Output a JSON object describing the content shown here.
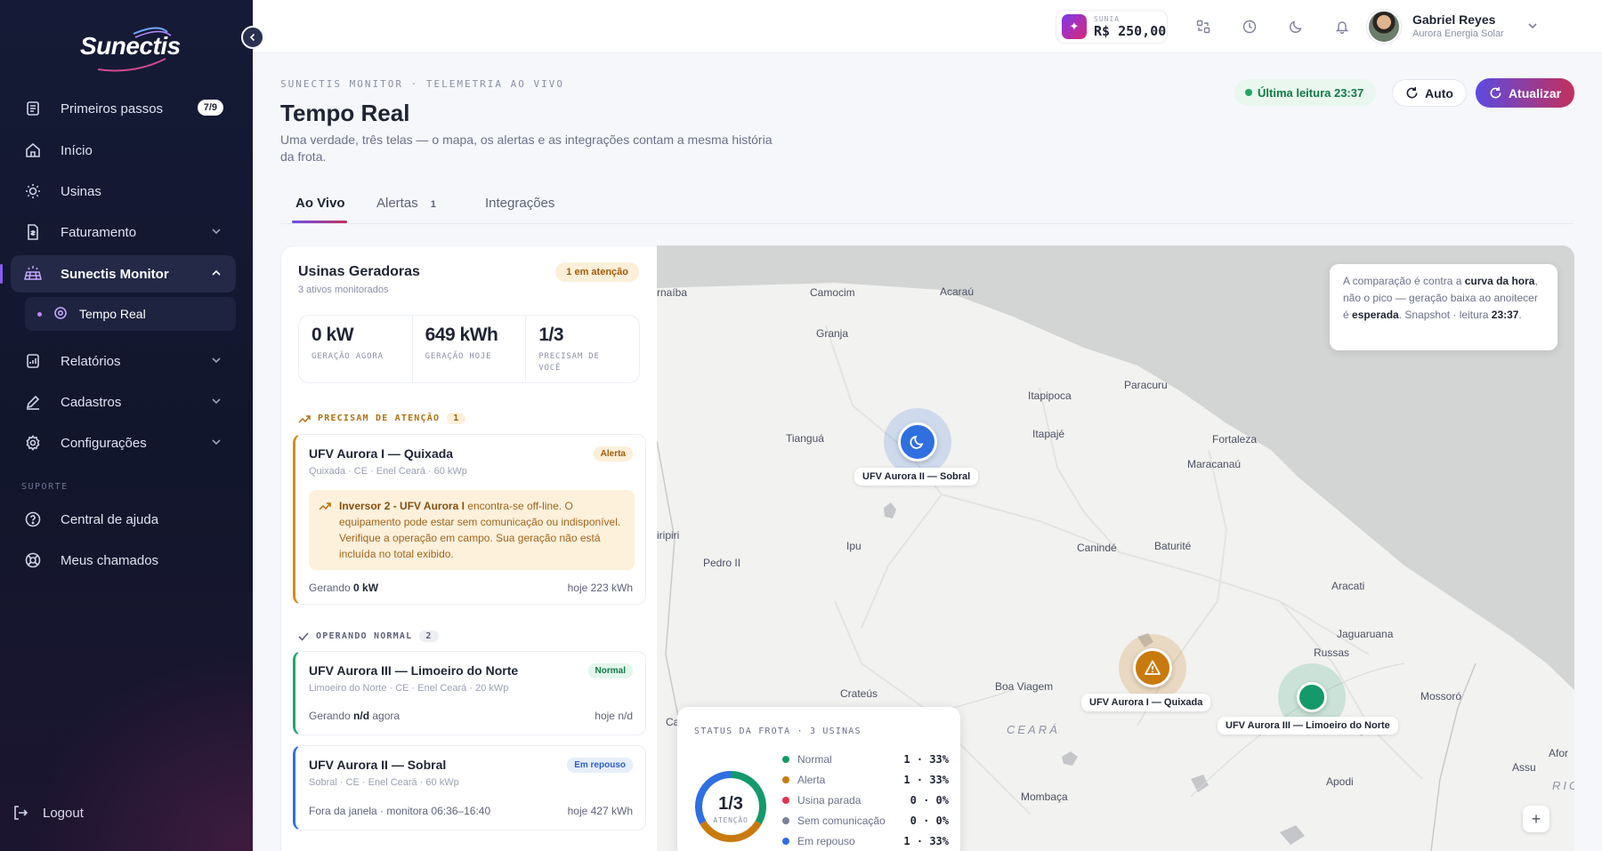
{
  "brand": {
    "name": "Sunectis"
  },
  "sidebar": {
    "items": [
      {
        "label": "Primeiros passos",
        "badge": "7/9",
        "icon": "checklist-icon"
      },
      {
        "label": "Início",
        "icon": "home-icon"
      },
      {
        "label": "Usinas",
        "icon": "sun-icon"
      },
      {
        "label": "Faturamento",
        "icon": "invoice-icon"
      },
      {
        "label": "Sunectis Monitor",
        "icon": "solar-panel-icon"
      },
      {
        "label": "Relatórios",
        "icon": "report-icon"
      },
      {
        "label": "Cadastros",
        "icon": "edit-icon"
      },
      {
        "label": "Configurações",
        "icon": "gear-icon"
      }
    ],
    "subitem": {
      "label": "Tempo Real",
      "icon": "location-icon"
    },
    "support_label": "SUPORTE",
    "support": [
      {
        "label": "Central de ajuda",
        "icon": "help-icon"
      },
      {
        "label": "Meus chamados",
        "icon": "lifebuoy-icon"
      }
    ],
    "logout": "Logout"
  },
  "topbar": {
    "wallet_label": "SUNIA",
    "wallet_value": "R$ 250,00",
    "user_name": "Gabriel Reyes",
    "user_org": "Aurora Energia Solar"
  },
  "header": {
    "kicker": "SUNECTIS MONITOR · TELEMETRIA AO VIVO",
    "title": "Tempo Real",
    "subtitle": "Uma verdade, três telas — o mapa, os alertas e as integrações contam a mesma história da frota.",
    "last_read": "Última leitura 23:37",
    "auto_label": "Auto",
    "refresh_label": "Atualizar"
  },
  "tabs": [
    {
      "label": "Ao Vivo"
    },
    {
      "label": "Alertas",
      "count": "1"
    },
    {
      "label": "Integrações"
    }
  ],
  "panel": {
    "title": "Usinas Geradoras",
    "subtitle": "3 ativos monitorados",
    "attention_badge": "1 em atenção",
    "stats": [
      {
        "value": "0 kW",
        "label": "GERAÇÃO AGORA"
      },
      {
        "value": "649 kWh",
        "label": "GERAÇÃO HOJE"
      },
      {
        "value": "1/3",
        "label": "PRECISAM DE VOCÊ"
      }
    ],
    "group_attention": {
      "label": "PRECISAM DE ATENÇÃO",
      "count": "1"
    },
    "group_normal": {
      "label": "OPERANDO NORMAL",
      "count": "2"
    },
    "plants": [
      {
        "name": "UFV Aurora I — Quixada",
        "location": "Quixada · CE · Enel Ceará · 60 kWp",
        "status": "Alerta",
        "alert_strong": "Inversor 2 - UFV Aurora I",
        "alert_text": " encontra-se off-line. O equipamento pode estar sem comunicação ou indisponível. Verifique a operação em campo. Sua geração não está incluída no total exibido.",
        "foot_prefix": "Gerando ",
        "foot_value": "0 kW",
        "foot_suffix": "",
        "today": "hoje 223 kWh"
      },
      {
        "name": "UFV Aurora III — Limoeiro do Norte",
        "location": "Limoeiro do Norte · CE · Enel Ceará · 20 kWp",
        "status": "Normal",
        "foot_prefix": "Gerando ",
        "foot_value": "n/d",
        "foot_suffix": " agora",
        "today": "hoje n/d"
      },
      {
        "name": "UFV Aurora II — Sobral",
        "location": "Sobral · CE · Enel Ceará · 60 kWp",
        "status": "Em repouso",
        "foot_text": "Fora da janela · monitora 06:36–16:40",
        "today": "hoje 427 kWh"
      }
    ]
  },
  "map": {
    "cities": [
      "rnaíba",
      "Camocim",
      "Acaraú",
      "Granja",
      "Itapipoca",
      "Paracuru",
      "Tianguá",
      "Itapajé",
      "Fortaleza",
      "Maracanaú",
      "iripiri",
      "Pedro II",
      "Ipu",
      "Canindé",
      "Baturité",
      "Aracati",
      "Jaguaruana",
      "Russas",
      "Crateús",
      "Boa Viagem",
      "CEARÁ",
      "Mossoró",
      "Ca",
      "Mombaça",
      "Apodi",
      "Assu",
      "Afor",
      "RIO"
    ],
    "markers": [
      {
        "label": "UFV Aurora II — Sobral",
        "status": "repouso",
        "color": "#2f6fe0",
        "icon": "moon-icon"
      },
      {
        "label": "UFV Aurora I — Quixada",
        "status": "alerta",
        "color": "#c97a0d",
        "icon": "warning-icon"
      },
      {
        "label": "UFV Aurora III — Limoeiro do Norte",
        "status": "normal",
        "color": "#14996b",
        "icon": "dot-icon"
      }
    ],
    "note": {
      "t1": "A comparação é contra a ",
      "b1": "curva da hora",
      "t2": ", não o pico — geração baixa ao anoitecer é ",
      "b2": "esperada",
      "t3": ". Snapshot · leitura ",
      "b3": "23:37",
      "t4": "."
    },
    "fleet": {
      "title": "STATUS DA FROTA · 3 USINAS",
      "center_value": "1/3",
      "center_label": "ATENÇÃO",
      "legend": [
        {
          "label": "Normal",
          "value": "1 · 33%",
          "color": "#14996b"
        },
        {
          "label": "Alerta",
          "value": "1 · 33%",
          "color": "#c97a0d"
        },
        {
          "label": "Usina parada",
          "value": "0 · 0%",
          "color": "#e0344f"
        },
        {
          "label": "Sem comunicação",
          "value": "0 · 0%",
          "color": "#7b8198"
        },
        {
          "label": "Em repouso",
          "value": "1 · 33%",
          "color": "#2f6fe0"
        }
      ]
    },
    "zoom_in": "+"
  }
}
